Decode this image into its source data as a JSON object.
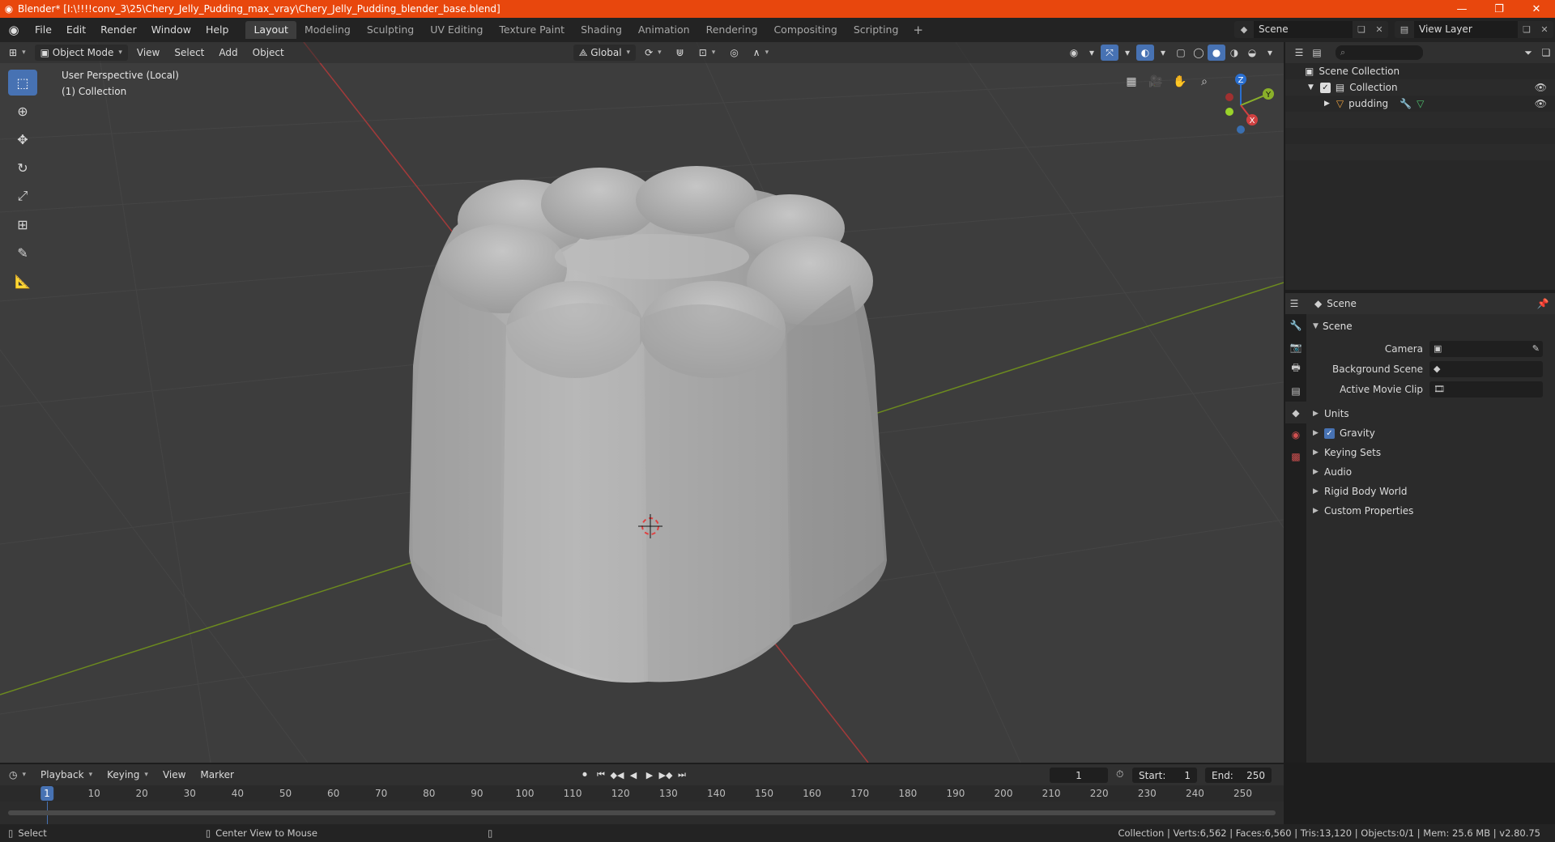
{
  "window": {
    "title": "Blender* [I:\\!!!!conv_3\\25\\Chery_Jelly_Pudding_max_vray\\Chery_Jelly_Pudding_blender_base.blend]",
    "controls": [
      "—",
      "❐",
      "✕"
    ]
  },
  "menu": [
    "File",
    "Edit",
    "Render",
    "Window",
    "Help"
  ],
  "workspaces": [
    "Layout",
    "Modeling",
    "Sculpting",
    "UV Editing",
    "Texture Paint",
    "Shading",
    "Animation",
    "Rendering",
    "Compositing",
    "Scripting"
  ],
  "workspace_active": "Layout",
  "scene_selector": "Scene",
  "view_layer_selector": "View Layer",
  "viewport": {
    "mode": "Object Mode",
    "menus": [
      "View",
      "Select",
      "Add",
      "Object"
    ],
    "transform_orientation": "Global",
    "info_line1": "User Perspective (Local)",
    "info_line2": "(1) Collection",
    "gizmo_labels": {
      "z": "Z",
      "y": "Y",
      "x": "X"
    },
    "colors": {
      "x_axis": "#c03a3a",
      "y_axis": "#7a9a1f",
      "accent": "#4772b3"
    }
  },
  "outliner": {
    "root": "Scene Collection",
    "collection": "Collection",
    "object": "pudding"
  },
  "properties": {
    "header": "Scene",
    "panel": "Scene",
    "rows": [
      {
        "label": "Camera"
      },
      {
        "label": "Background Scene"
      },
      {
        "label": "Active Movie Clip"
      }
    ],
    "subpanels": [
      "Units",
      "Gravity",
      "Keying Sets",
      "Audio",
      "Rigid Body World",
      "Custom Properties"
    ]
  },
  "timeline": {
    "menus": [
      "Playback",
      "Keying",
      "View",
      "Marker"
    ],
    "current_frame": "1",
    "start_label": "Start:",
    "start_value": "1",
    "end_label": "End:",
    "end_value": "250",
    "ticks": [
      "10",
      "20",
      "30",
      "40",
      "50",
      "60",
      "70",
      "80",
      "90",
      "100",
      "110",
      "120",
      "130",
      "140",
      "150",
      "160",
      "170",
      "180",
      "190",
      "200",
      "210",
      "220",
      "230",
      "240",
      "250"
    ]
  },
  "statusbar": {
    "left1": "Select",
    "left2": "Center View to Mouse",
    "right": "Collection | Verts:6,562 | Faces:6,560 | Tris:13,120 | Objects:0/1 | Mem: 25.6 MB | v2.80.75"
  }
}
